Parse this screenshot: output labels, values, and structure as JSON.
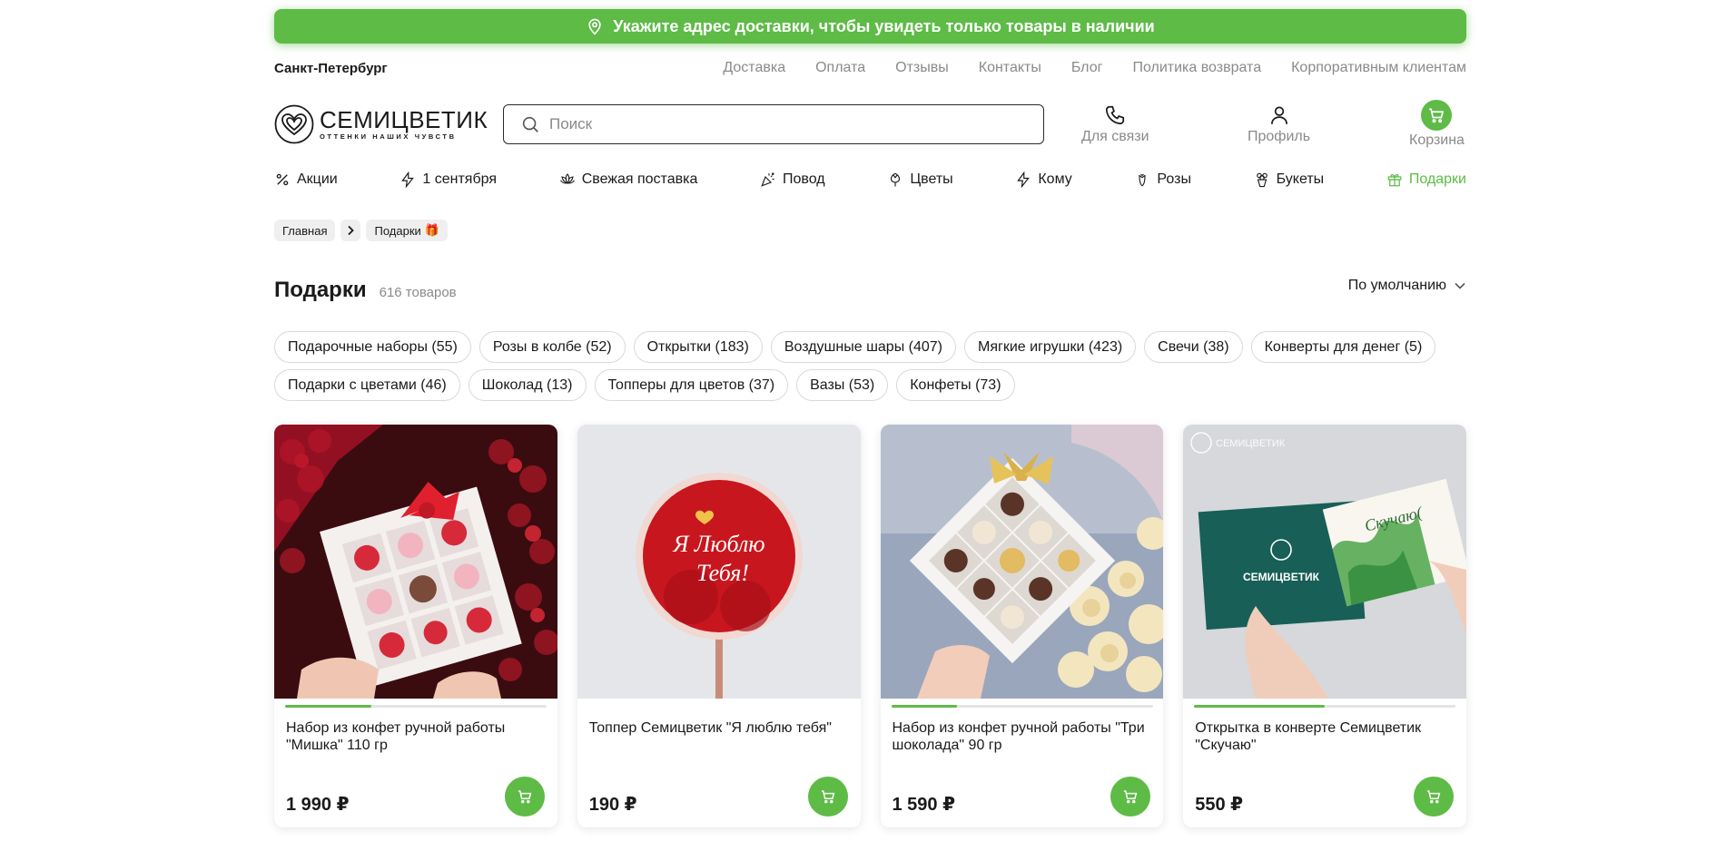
{
  "banner": {
    "text": "Укажите адрес доставки, чтобы увидеть только товары в наличии",
    "icon": "location-pin-icon"
  },
  "city": "Санкт-Петербург",
  "top_links": [
    "Доставка",
    "Оплата",
    "Отзывы",
    "Контакты",
    "Блог",
    "Политика возврата",
    "Корпоративным клиентам"
  ],
  "logo": {
    "name": "СЕМИЦВЕТИК",
    "tagline": "ОТТЕНКИ НАШИХ ЧУВСТВ"
  },
  "search": {
    "placeholder": "Поиск"
  },
  "header_actions": {
    "contact": "Для связи",
    "profile": "Профиль",
    "cart": "Корзина"
  },
  "nav": [
    {
      "label": "Акции",
      "icon": "percent-icon"
    },
    {
      "label": "1 сентября",
      "icon": "lightning-icon"
    },
    {
      "label": "Свежая поставка",
      "icon": "lotus-icon"
    },
    {
      "label": "Повод",
      "icon": "party-icon"
    },
    {
      "label": "Цветы",
      "icon": "tulip-icon"
    },
    {
      "label": "Кому",
      "icon": "lightning-icon"
    },
    {
      "label": "Розы",
      "icon": "rose-icon"
    },
    {
      "label": "Букеты",
      "icon": "bouquet-icon"
    },
    {
      "label": "Подарки",
      "icon": "gift-icon",
      "active": true
    }
  ],
  "breadcrumb": {
    "home": "Главная",
    "current": "Подарки",
    "current_emoji": "🎁"
  },
  "page": {
    "title": "Подарки",
    "count": "616 товаров",
    "sort": "По умолчанию"
  },
  "chips_row1": [
    "Подарочные наборы (55)",
    "Розы в колбе (52)",
    "Открытки (183)",
    "Воздушные шары (407)",
    "Мягкие игрушки (423)",
    "Свечи (38)",
    "Конверты для денег (5)"
  ],
  "chips_row2": [
    "Подарки с цветами (46)",
    "Шоколад (13)",
    "Топперы для цветов (37)",
    "Вазы (53)",
    "Конфеты (73)"
  ],
  "products": [
    {
      "name": "Набор из конфет ручной работы \"Мишка\" 110 гр",
      "price": "1 990 ₽",
      "progress": 0.33
    },
    {
      "name": "Топпер Семицветик \"Я люблю тебя\"",
      "price": "190 ₽",
      "progress": null,
      "topper_text_1": "Я Люблю",
      "topper_text_2": "Тебя!"
    },
    {
      "name": "Набор из конфет ручной работы \"Три шоколада\" 90 гр",
      "price": "1 590 ₽",
      "progress": 0.25
    },
    {
      "name": "Открытка в конверте Семицветик \"Скучаю\"",
      "price": "550 ₽",
      "progress": 0.5,
      "envelope_text": "СЕМИЦВЕТИК",
      "card_text": "Скучаю(",
      "watermark": "СЕМИЦВЕТИК"
    }
  ],
  "colors": {
    "accent": "#5dbb46",
    "muted": "#8a8a8a"
  }
}
